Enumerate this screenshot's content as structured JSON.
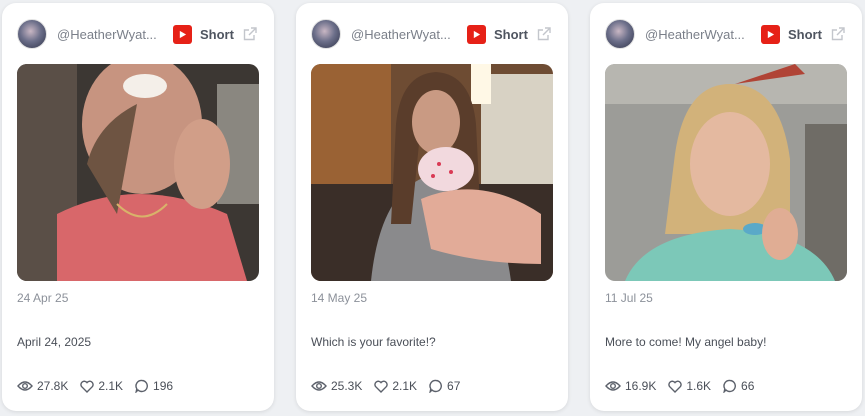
{
  "cards": [
    {
      "handle": "@HeatherWyat...",
      "platform_icon": "youtube-icon",
      "type_label": "Short",
      "date": "24 Apr 25",
      "caption": "April 24, 2025",
      "views": "27.8K",
      "likes": "2.1K",
      "comments": "196"
    },
    {
      "handle": "@HeatherWyat...",
      "platform_icon": "youtube-icon",
      "type_label": "Short",
      "date": "14 May 25",
      "caption": "Which is your favorite!?",
      "views": "25.3K",
      "likes": "2.1K",
      "comments": "67"
    },
    {
      "handle": "@HeatherWyat...",
      "platform_icon": "youtube-icon",
      "type_label": "Short",
      "date": "11 Jul 25",
      "caption": "More to come! My angel baby!",
      "views": "16.9K",
      "likes": "1.6K",
      "comments": "66"
    }
  ],
  "colors": {
    "youtube_red": "#e62117",
    "page_bg": "#eef0f3",
    "card_bg": "#ffffff"
  }
}
